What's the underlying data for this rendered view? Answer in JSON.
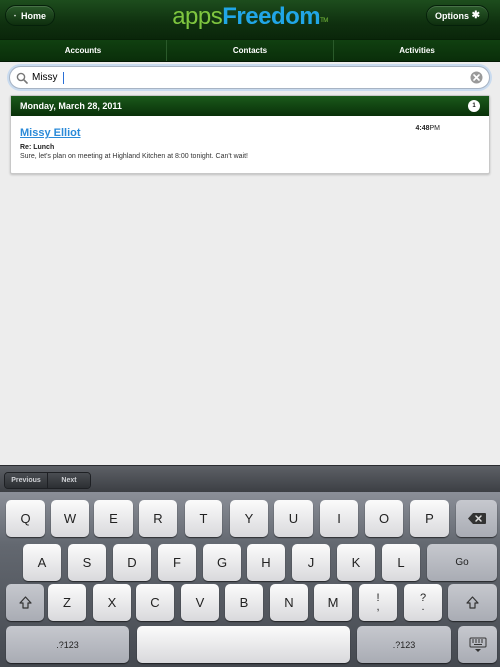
{
  "header": {
    "home_label": "Home",
    "options_label": "Options",
    "logo_apps": "apps",
    "logo_freedom": "Freedom",
    "logo_tm": "TM",
    "home_icon": "home-icon",
    "options_icon": "gear-icon",
    "background_color": "#0f300f"
  },
  "tabs": [
    {
      "label": "Accounts"
    },
    {
      "label": "Contacts"
    },
    {
      "label": "Activities"
    }
  ],
  "search": {
    "value": "Missy",
    "placeholder": "",
    "search_icon": "search-icon",
    "clear_icon": "clear-icon"
  },
  "results": {
    "date_header": "Monday, March 28, 2011",
    "count": "1",
    "entry": {
      "name": "Missy Elliot",
      "subject": "Re: Lunch",
      "body": "Sure, let's plan on meeting at Highland Kitchen at 8:00 tonight. Can't wait!",
      "time": "4:48",
      "ampm": "PM",
      "link_color": "#2a8ad8"
    }
  },
  "keyboard": {
    "previous_label": "Previous",
    "next_label": "Next",
    "row1": [
      "Q",
      "W",
      "E",
      "R",
      "T",
      "Y",
      "U",
      "I",
      "O",
      "P"
    ],
    "row2": [
      "A",
      "S",
      "D",
      "F",
      "G",
      "H",
      "J",
      "K",
      "L"
    ],
    "go_label": "Go",
    "row3": [
      "Z",
      "X",
      "C",
      "V",
      "B",
      "N",
      "M"
    ],
    "excl_top": "!",
    "excl_bottom": ",",
    "quest_top": "?",
    "quest_bottom": ".",
    "numbers_label": ".?123",
    "backspace_icon": "backspace-icon",
    "shift_icon": "shift-icon",
    "hide_keyboard_icon": "hide-keyboard-icon"
  }
}
